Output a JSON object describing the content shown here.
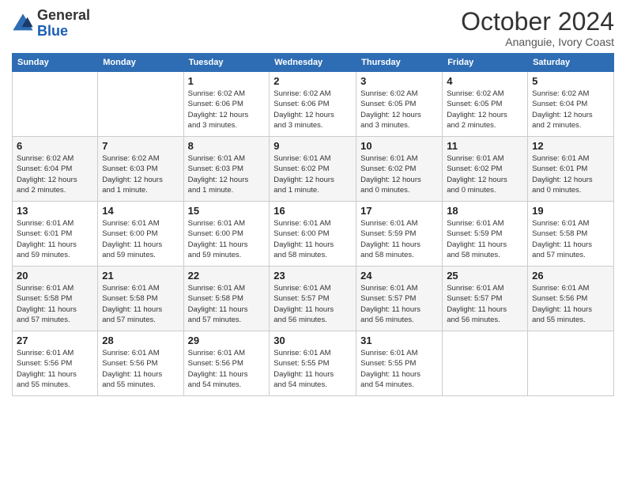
{
  "logo": {
    "line1": "General",
    "line2": "Blue"
  },
  "title": "October 2024",
  "subtitle": "Ananguie, Ivory Coast",
  "weekdays": [
    "Sunday",
    "Monday",
    "Tuesday",
    "Wednesday",
    "Thursday",
    "Friday",
    "Saturday"
  ],
  "weeks": [
    [
      {
        "day": "",
        "info": ""
      },
      {
        "day": "",
        "info": ""
      },
      {
        "day": "1",
        "info": "Sunrise: 6:02 AM\nSunset: 6:06 PM\nDaylight: 12 hours\nand 3 minutes."
      },
      {
        "day": "2",
        "info": "Sunrise: 6:02 AM\nSunset: 6:06 PM\nDaylight: 12 hours\nand 3 minutes."
      },
      {
        "day": "3",
        "info": "Sunrise: 6:02 AM\nSunset: 6:05 PM\nDaylight: 12 hours\nand 3 minutes."
      },
      {
        "day": "4",
        "info": "Sunrise: 6:02 AM\nSunset: 6:05 PM\nDaylight: 12 hours\nand 2 minutes."
      },
      {
        "day": "5",
        "info": "Sunrise: 6:02 AM\nSunset: 6:04 PM\nDaylight: 12 hours\nand 2 minutes."
      }
    ],
    [
      {
        "day": "6",
        "info": "Sunrise: 6:02 AM\nSunset: 6:04 PM\nDaylight: 12 hours\nand 2 minutes."
      },
      {
        "day": "7",
        "info": "Sunrise: 6:02 AM\nSunset: 6:03 PM\nDaylight: 12 hours\nand 1 minute."
      },
      {
        "day": "8",
        "info": "Sunrise: 6:01 AM\nSunset: 6:03 PM\nDaylight: 12 hours\nand 1 minute."
      },
      {
        "day": "9",
        "info": "Sunrise: 6:01 AM\nSunset: 6:02 PM\nDaylight: 12 hours\nand 1 minute."
      },
      {
        "day": "10",
        "info": "Sunrise: 6:01 AM\nSunset: 6:02 PM\nDaylight: 12 hours\nand 0 minutes."
      },
      {
        "day": "11",
        "info": "Sunrise: 6:01 AM\nSunset: 6:02 PM\nDaylight: 12 hours\nand 0 minutes."
      },
      {
        "day": "12",
        "info": "Sunrise: 6:01 AM\nSunset: 6:01 PM\nDaylight: 12 hours\nand 0 minutes."
      }
    ],
    [
      {
        "day": "13",
        "info": "Sunrise: 6:01 AM\nSunset: 6:01 PM\nDaylight: 11 hours\nand 59 minutes."
      },
      {
        "day": "14",
        "info": "Sunrise: 6:01 AM\nSunset: 6:00 PM\nDaylight: 11 hours\nand 59 minutes."
      },
      {
        "day": "15",
        "info": "Sunrise: 6:01 AM\nSunset: 6:00 PM\nDaylight: 11 hours\nand 59 minutes."
      },
      {
        "day": "16",
        "info": "Sunrise: 6:01 AM\nSunset: 6:00 PM\nDaylight: 11 hours\nand 58 minutes."
      },
      {
        "day": "17",
        "info": "Sunrise: 6:01 AM\nSunset: 5:59 PM\nDaylight: 11 hours\nand 58 minutes."
      },
      {
        "day": "18",
        "info": "Sunrise: 6:01 AM\nSunset: 5:59 PM\nDaylight: 11 hours\nand 58 minutes."
      },
      {
        "day": "19",
        "info": "Sunrise: 6:01 AM\nSunset: 5:58 PM\nDaylight: 11 hours\nand 57 minutes."
      }
    ],
    [
      {
        "day": "20",
        "info": "Sunrise: 6:01 AM\nSunset: 5:58 PM\nDaylight: 11 hours\nand 57 minutes."
      },
      {
        "day": "21",
        "info": "Sunrise: 6:01 AM\nSunset: 5:58 PM\nDaylight: 11 hours\nand 57 minutes."
      },
      {
        "day": "22",
        "info": "Sunrise: 6:01 AM\nSunset: 5:58 PM\nDaylight: 11 hours\nand 57 minutes."
      },
      {
        "day": "23",
        "info": "Sunrise: 6:01 AM\nSunset: 5:57 PM\nDaylight: 11 hours\nand 56 minutes."
      },
      {
        "day": "24",
        "info": "Sunrise: 6:01 AM\nSunset: 5:57 PM\nDaylight: 11 hours\nand 56 minutes."
      },
      {
        "day": "25",
        "info": "Sunrise: 6:01 AM\nSunset: 5:57 PM\nDaylight: 11 hours\nand 56 minutes."
      },
      {
        "day": "26",
        "info": "Sunrise: 6:01 AM\nSunset: 5:56 PM\nDaylight: 11 hours\nand 55 minutes."
      }
    ],
    [
      {
        "day": "27",
        "info": "Sunrise: 6:01 AM\nSunset: 5:56 PM\nDaylight: 11 hours\nand 55 minutes."
      },
      {
        "day": "28",
        "info": "Sunrise: 6:01 AM\nSunset: 5:56 PM\nDaylight: 11 hours\nand 55 minutes."
      },
      {
        "day": "29",
        "info": "Sunrise: 6:01 AM\nSunset: 5:56 PM\nDaylight: 11 hours\nand 54 minutes."
      },
      {
        "day": "30",
        "info": "Sunrise: 6:01 AM\nSunset: 5:55 PM\nDaylight: 11 hours\nand 54 minutes."
      },
      {
        "day": "31",
        "info": "Sunrise: 6:01 AM\nSunset: 5:55 PM\nDaylight: 11 hours\nand 54 minutes."
      },
      {
        "day": "",
        "info": ""
      },
      {
        "day": "",
        "info": ""
      }
    ]
  ]
}
